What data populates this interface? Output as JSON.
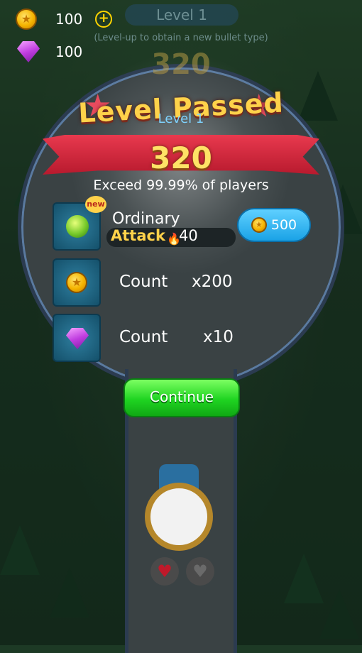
{
  "resources": {
    "coins": "100",
    "gems": "100",
    "plus_icon": "plus-icon"
  },
  "header": {
    "level": "Level 1",
    "hint": "(Level-up to obtain a new bullet type)"
  },
  "result": {
    "title": "Level Passed",
    "level": "Level 1",
    "score": "320",
    "exceed": "Exceed 99.99% of players"
  },
  "reward_bullet": {
    "badge": "new",
    "name": "Ordinary",
    "attack_label": "Attack",
    "attack_value": "40",
    "buy_price": "500"
  },
  "rewards": [
    {
      "label": "Count",
      "count": "x200",
      "icon": "coin-icon"
    },
    {
      "label": "Count",
      "count": "x10",
      "icon": "gem-icon"
    }
  ],
  "continue_label": "Continue",
  "colors": {
    "accent_green": "#1fd421",
    "ribbon_red": "#e8394e",
    "gold": "#ffd24a",
    "sky": "#1aa2e6"
  }
}
